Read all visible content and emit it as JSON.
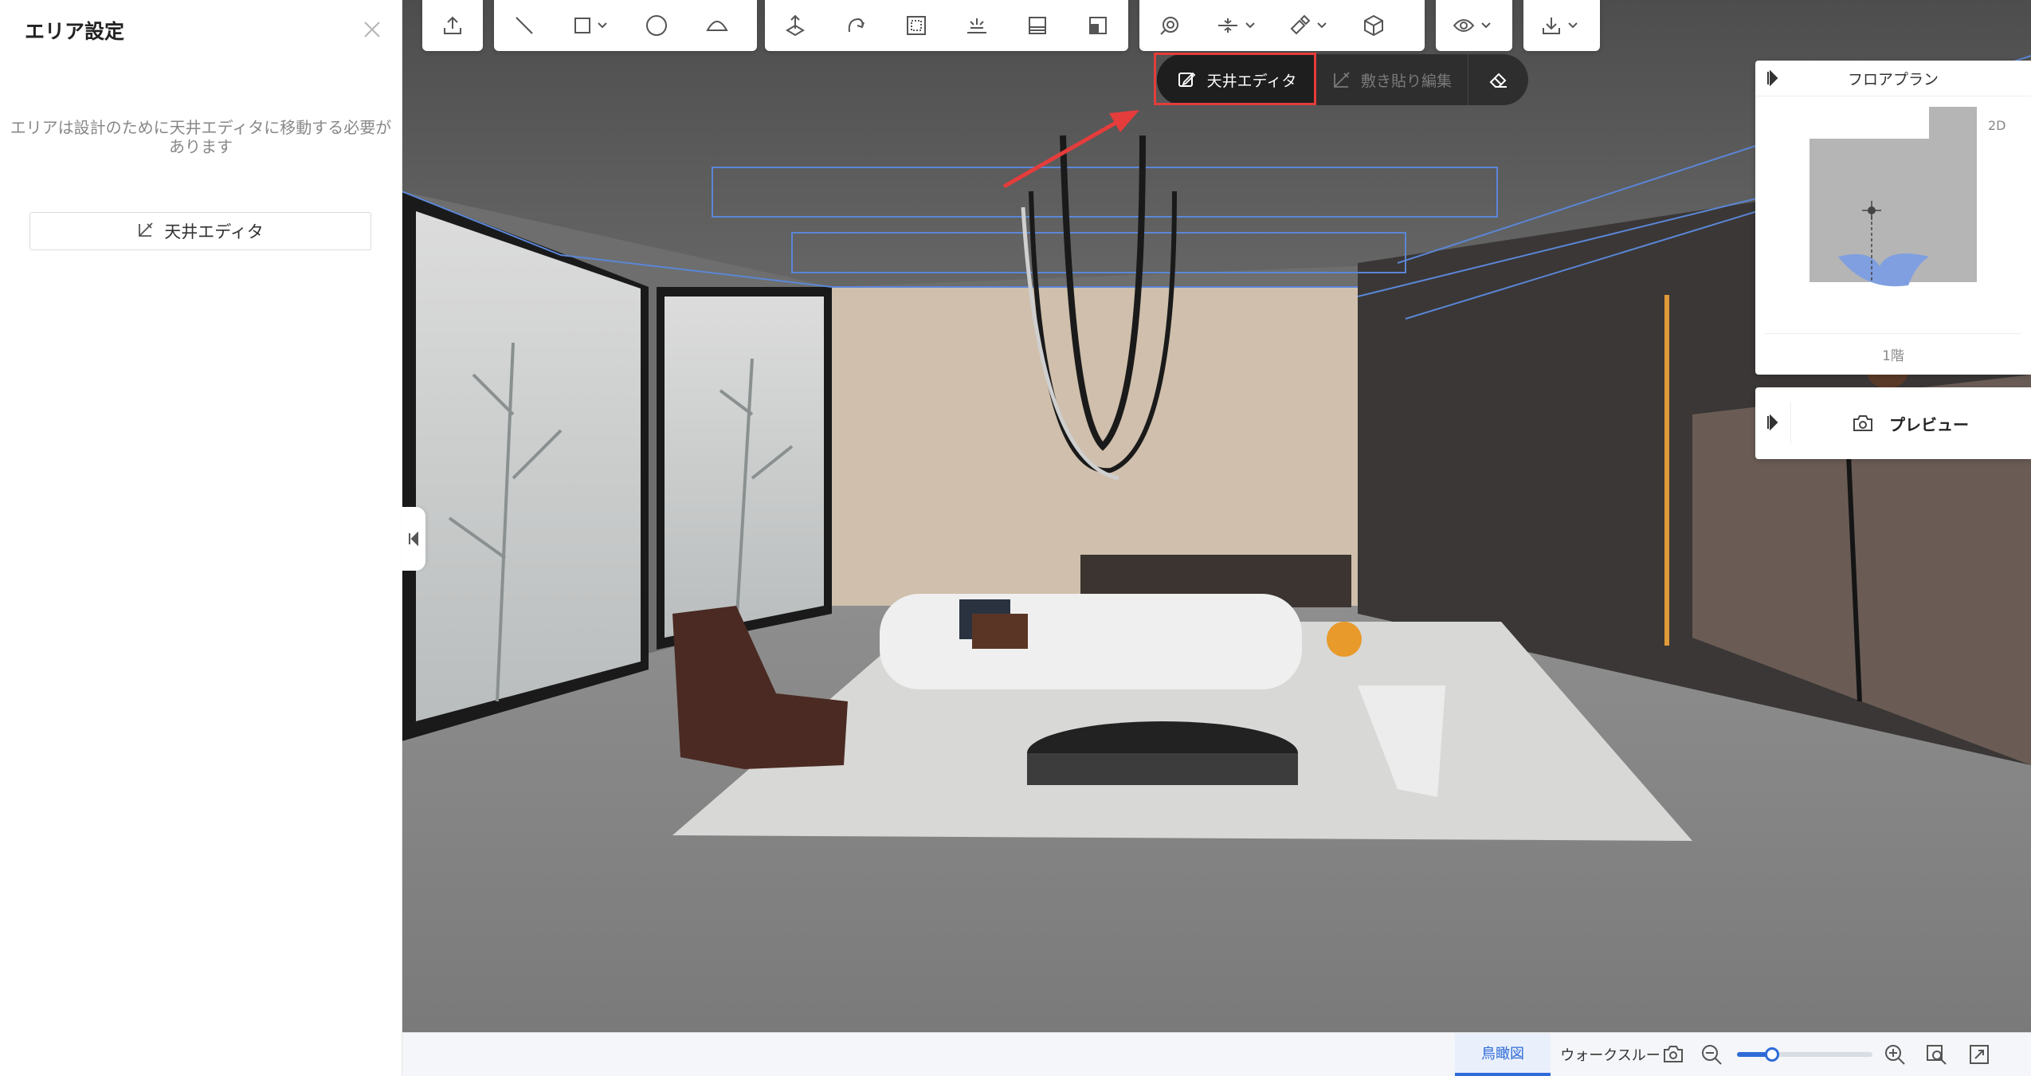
{
  "left_panel": {
    "title": "エリア設定",
    "close_icon": "close-icon",
    "description_line1": "エリアは設計のために天井エディタに移動する必要が",
    "description_line2": "あります",
    "ceiling_editor_button": "天井エディタ"
  },
  "toolbar": {
    "groups": [
      [
        "upload-icon"
      ],
      [
        "line-icon",
        "rectangle-icon",
        "circle-icon",
        "arc-icon"
      ],
      [
        "extrude-icon",
        "rotate-icon",
        "frame-icon",
        "light-icon",
        "panel-icon",
        "split-panel-icon"
      ],
      [
        "search-3d-icon",
        "align-icon",
        "paint-icon",
        "material-icon"
      ],
      [
        "eye-icon"
      ],
      [
        "download-icon"
      ]
    ]
  },
  "ceiling_toolbar": {
    "ceiling_editor": "天井エディタ",
    "tile_edit": "敷き貼り編集",
    "eraser_icon": "eraser-icon"
  },
  "floorplan": {
    "title": "フロアプラン",
    "mode": "2D",
    "floor": "1階"
  },
  "preview": {
    "label": "プレビュー"
  },
  "bottom_bar": {
    "birdseye_tab": "鳥瞰図",
    "walkthrough_tab": "ウォークスルー",
    "zoom_level": 0.26
  },
  "colors": {
    "accent": "#2f6bd8",
    "highlight": "#e53c3c",
    "floor": "#8a8a8a",
    "ceiling": "#5a5a5a",
    "wall": "#c9b8a4"
  }
}
